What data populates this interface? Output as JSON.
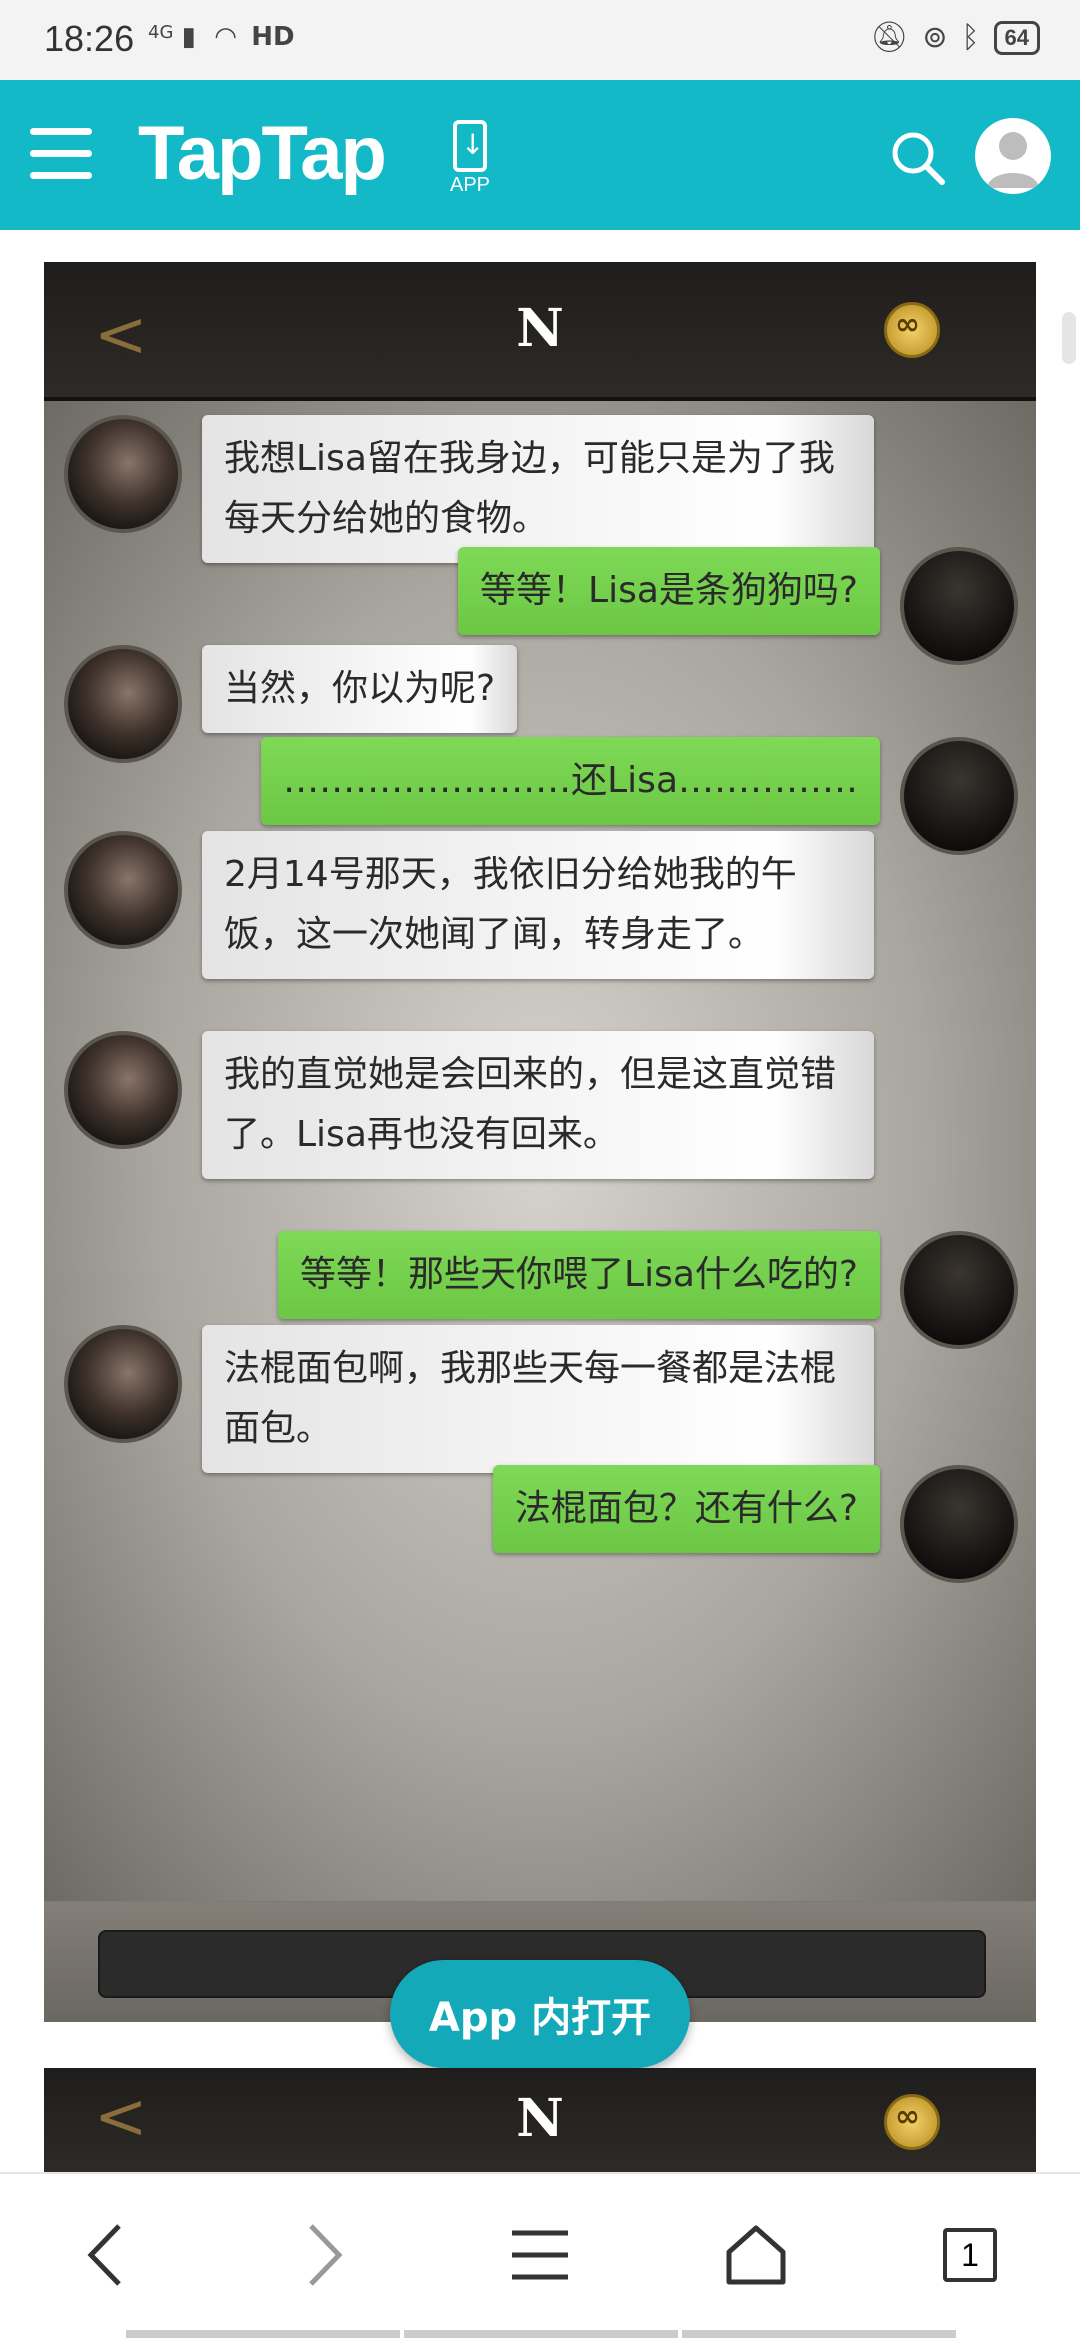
{
  "status_bar": {
    "time": "18:26",
    "network_text": "4G",
    "hd_text": "HD",
    "battery": "64"
  },
  "header": {
    "brand": "TapTap",
    "app_label": "APP"
  },
  "game": {
    "title": "N",
    "messages": [
      {
        "side": "left",
        "text": "我想Lisa留在我身边，可能只是为了我每天分给她的食物。"
      },
      {
        "side": "right",
        "text": "等等！Lisa是条狗狗吗?"
      },
      {
        "side": "left",
        "text": "当然，你以为呢?"
      },
      {
        "side": "right",
        "text": "……………………还Lisa……………"
      },
      {
        "side": "left",
        "text": "2月14号那天，我依旧分给她我的午饭，这一次她闻了闻，转身走了。"
      },
      {
        "side": "left",
        "text": "我的直觉她是会回来的，但是这直觉错了。Lisa再也没有回来。"
      },
      {
        "side": "right",
        "text": "等等！那些天你喂了Lisa什么吃的?"
      },
      {
        "side": "left",
        "text": "法棍面包啊，我那些天每一餐都是法棍面包。"
      },
      {
        "side": "right",
        "text": "法棍面包？还有什么?"
      }
    ]
  },
  "open_app_button": "App 内打开",
  "game2": {
    "title": "N"
  },
  "browser_nav": {
    "back_icon": "‹",
    "forward_icon": "›",
    "tabs_count": "1"
  }
}
